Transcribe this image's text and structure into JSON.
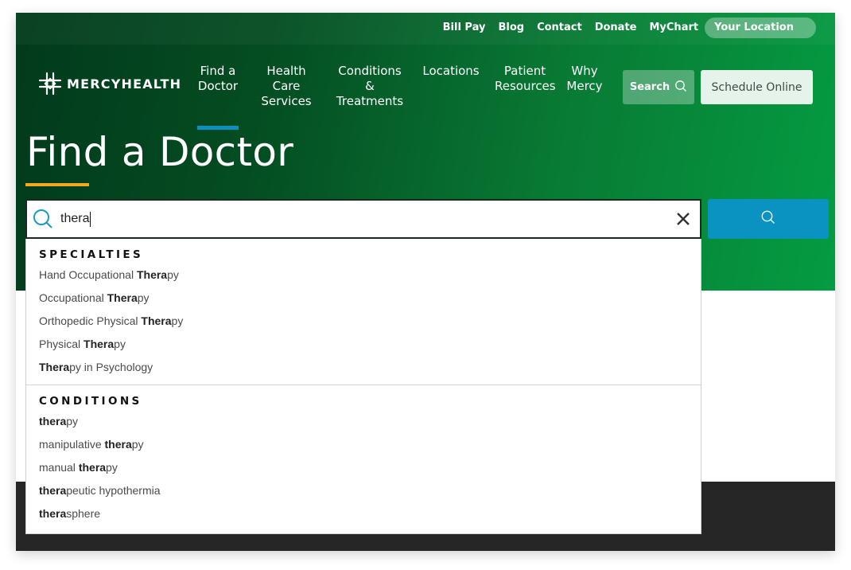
{
  "utility_nav": {
    "links": [
      "Bill Pay",
      "Blog",
      "Contact",
      "Donate",
      "MyChart"
    ],
    "location_label": "Your Location"
  },
  "brand": {
    "logo_text": "MERCYHEALTH"
  },
  "main_nav": {
    "items": [
      {
        "lines": [
          "Find a",
          "Doctor"
        ],
        "active": true
      },
      {
        "lines": [
          "Health",
          "Care",
          "Services"
        ],
        "active": false
      },
      {
        "lines": [
          "Conditions",
          "&",
          "Treatments"
        ],
        "active": false
      },
      {
        "lines": [
          "Locations"
        ],
        "active": false
      },
      {
        "lines": [
          "Patient",
          "Resources"
        ],
        "active": false
      },
      {
        "lines": [
          "Why",
          "Mercy"
        ],
        "active": false
      }
    ],
    "search_label": "Search",
    "schedule_label": "Schedule Online"
  },
  "page": {
    "title": "Find a Doctor"
  },
  "search": {
    "value": "thera",
    "placeholder": ""
  },
  "autocomplete": {
    "query": "thera",
    "sections": [
      {
        "heading": "SPECIALTIES",
        "items": [
          {
            "before": "Hand Occupational ",
            "match": "Thera",
            "after": "py"
          },
          {
            "before": "Occupational ",
            "match": "Thera",
            "after": "py"
          },
          {
            "before": "Orthopedic Physical ",
            "match": "Thera",
            "after": "py"
          },
          {
            "before": "Physical ",
            "match": "Thera",
            "after": "py"
          },
          {
            "before": "",
            "match": "Thera",
            "after": "py in Psychology"
          }
        ]
      },
      {
        "heading": "CONDITIONS",
        "items": [
          {
            "before": "",
            "match": "thera",
            "after": "py"
          },
          {
            "before": "manipulative ",
            "match": "thera",
            "after": "py"
          },
          {
            "before": "manual ",
            "match": "thera",
            "after": "py"
          },
          {
            "before": "",
            "match": "thera",
            "after": "peutic hypothermia"
          },
          {
            "before": "",
            "match": "thera",
            "after": "sphere"
          }
        ]
      }
    ]
  },
  "colors": {
    "brand_green_dark": "#023a1c",
    "brand_green_light": "#049c42",
    "accent_blue": "#0a93c0",
    "title_underline": "#f5a623",
    "footer": "#262626"
  }
}
